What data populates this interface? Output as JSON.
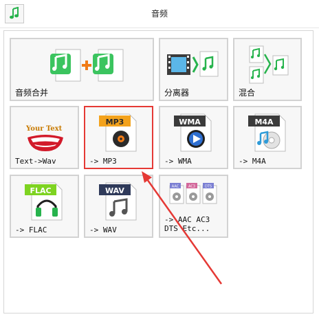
{
  "window": {
    "title": "音频"
  },
  "tiles": [
    {
      "label": "音频合并"
    },
    {
      "label": "分离器"
    },
    {
      "label": "混合"
    },
    {
      "label": "Text->Wav",
      "badge": "Your Text"
    },
    {
      "label": "-> MP3",
      "badge": "MP3"
    },
    {
      "label": "-> WMA",
      "badge": "WMA"
    },
    {
      "label": "-> M4A",
      "badge": "M4A"
    },
    {
      "label": "-> FLAC",
      "badge": "FLAC"
    },
    {
      "label": "-> WAV",
      "badge": "WAV"
    },
    {
      "label": "-> AAC AC3\nDTS Etc...",
      "badges": [
        "AAC",
        "AC3",
        "DTS"
      ]
    }
  ],
  "colors": {
    "accent_green": "#27b34d",
    "mp3_orange": "#f3a21c",
    "wma_blue": "#2e6fd1",
    "highlight": "#e53935"
  }
}
